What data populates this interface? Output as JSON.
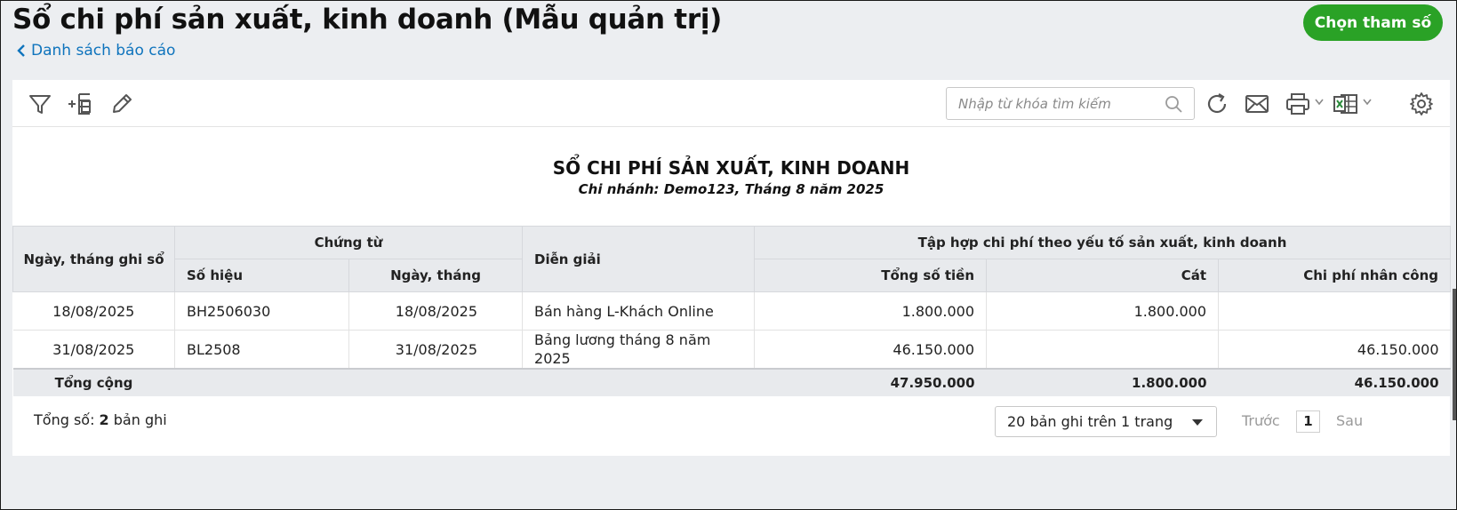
{
  "header": {
    "title": "Sổ chi phí sản xuất, kinh doanh (Mẫu quản trị)",
    "back_label": "Danh sách báo cáo",
    "primary_button": "Chọn tham số"
  },
  "toolbar": {
    "search_placeholder": "Nhập từ khóa tìm kiếm",
    "icons": [
      "filter-icon",
      "add-column-icon",
      "edit-icon",
      "refresh-icon",
      "email-icon",
      "print-icon",
      "excel-icon",
      "settings-icon"
    ]
  },
  "report": {
    "title": "SỔ CHI PHÍ SẢN XUẤT, KINH DOANH",
    "subtitle": "Chi nhánh: Demo123, Tháng 8 năm 2025"
  },
  "table": {
    "headers": {
      "date_recorded": "Ngày, tháng ghi sổ",
      "voucher": "Chứng từ",
      "voucher_no": "Số hiệu",
      "voucher_date": "Ngày, tháng",
      "description": "Diễn giải",
      "cost_group": "Tập hợp chi phí theo yếu tố sản xuất, kinh doanh",
      "total": "Tổng số tiền",
      "sand": "Cát",
      "labor": "Chi phí nhân công"
    },
    "rows": [
      {
        "date_recorded": "18/08/2025",
        "voucher_no": "BH2506030",
        "voucher_date": "18/08/2025",
        "description": "Bán hàng L-Khách Online",
        "total": "1.800.000",
        "sand": "1.800.000",
        "labor": ""
      },
      {
        "date_recorded": "31/08/2025",
        "voucher_no": "BL2508",
        "voucher_date": "31/08/2025",
        "description": "Bảng lương tháng 8 năm 2025",
        "total": "46.150.000",
        "sand": "",
        "labor": "46.150.000"
      }
    ],
    "totals": {
      "label": "Tổng cộng",
      "total": "47.950.000",
      "sand": "1.800.000",
      "labor": "46.150.000"
    }
  },
  "footer": {
    "count_prefix": "Tổng số: ",
    "count_value": "2",
    "count_suffix": " bản ghi",
    "page_size": "20 bản ghi trên 1 trang",
    "prev": "Trước",
    "page": "1",
    "next": "Sau"
  },
  "colors": {
    "accent": "#2aa226",
    "link": "#0f74bd",
    "header_bg": "#e8eaed"
  }
}
